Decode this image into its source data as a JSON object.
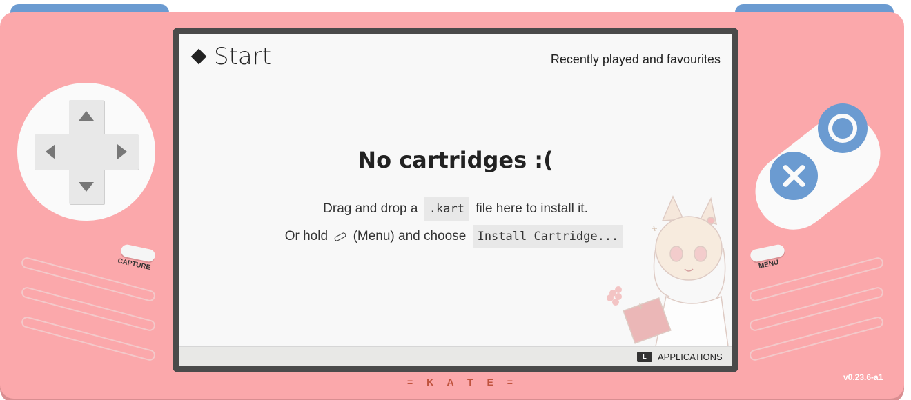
{
  "screen": {
    "title": "Start",
    "subtitle": "Recently played and favourites",
    "empty_title": "No cartridges :(",
    "line1_pre": "Drag and drop a",
    "line1_code": ".kart",
    "line1_post": "file here to install it.",
    "line2_pre": "Or hold",
    "line2_mid": "(Menu) and choose",
    "line2_code": "Install Cartridge...",
    "footer_key": "L",
    "footer_label": "APPLICATIONS"
  },
  "console": {
    "capture_label": "CAPTURE",
    "menu_label": "MENU",
    "brand": "= K A T E =",
    "version": "v0.23.6-a1"
  },
  "icons": {
    "title": "diamond-icon",
    "menu_button": "menu-pill-icon",
    "dpad": "dpad-icon",
    "ok": "circle-button-icon",
    "cancel": "x-button-icon"
  },
  "colors": {
    "body": "#fba8ab",
    "accent": "#6b9bd1",
    "brand": "#c0533e"
  }
}
